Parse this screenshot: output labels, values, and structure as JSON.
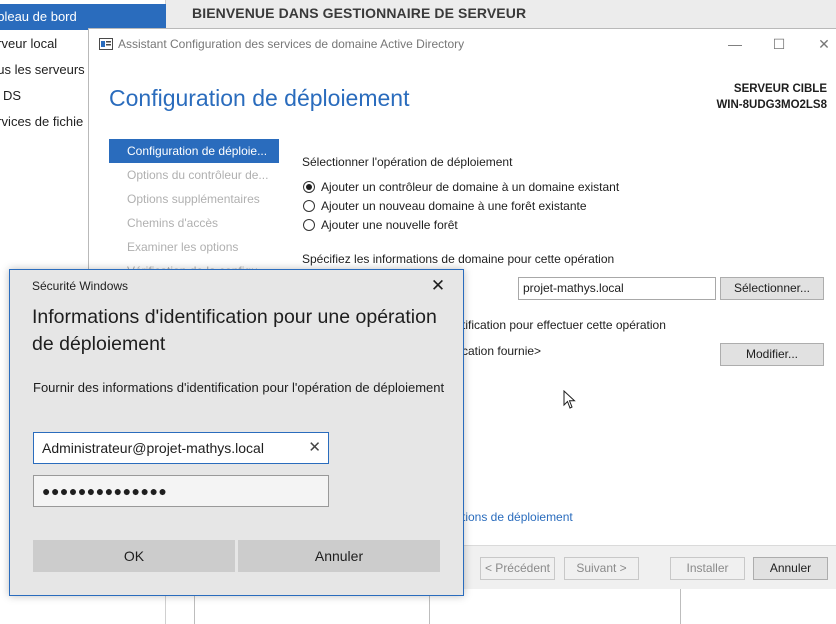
{
  "server_manager": {
    "header_title": "BIENVENUE DANS GESTIONNAIRE DE SERVEUR",
    "sidebar": [
      {
        "label": "ableau de bord",
        "active": true
      },
      {
        "label": "erveur local",
        "active": false
      },
      {
        "label": "ous les serveurs",
        "active": false
      },
      {
        "label": "D DS",
        "active": false
      },
      {
        "label": "ervices de fichie",
        "active": false
      }
    ]
  },
  "wizard": {
    "window_title": "Assistant Configuration des services de domaine Active Directory",
    "heading": "Configuration de déploiement",
    "target_label": "SERVEUR CIBLE",
    "target_name": "WIN-8UDG3MO2LS8",
    "nav": [
      {
        "label": "Configuration de déploie...",
        "active": true
      },
      {
        "label": "Options du contrôleur de...",
        "active": false
      },
      {
        "label": "Options supplémentaires",
        "active": false
      },
      {
        "label": "Chemins d'accès",
        "active": false
      },
      {
        "label": "Examiner les options",
        "active": false
      },
      {
        "label": "Vérification de la configu...",
        "active": false
      }
    ],
    "select_operation_label": "Sélectionner l'opération de déploiement",
    "options": [
      {
        "label": "Ajouter un contrôleur de domaine à un domaine existant",
        "checked": true
      },
      {
        "label": "Ajouter un nouveau domaine à une forêt existante",
        "checked": false
      },
      {
        "label": "Ajouter une nouvelle forêt",
        "checked": false
      }
    ],
    "domain_info_label": "Spécifiez les informations de domaine pour cette opération",
    "domain_value": "projet-mathys.local",
    "select_button": "Sélectionner...",
    "credentials_label_partial": "tification pour effectuer cette opération",
    "credentials_value_partial": "cation fournie>",
    "modify_button": "Modifier...",
    "link_partial": "tions de déploiement",
    "footer": {
      "previous": "< Précédent",
      "next": "Suivant >",
      "install": "Installer",
      "cancel": "Annuler"
    }
  },
  "security_dialog": {
    "title": "Sécurité Windows",
    "heading": "Informations d'identification pour une opération de déploiement",
    "description": "Fournir des informations d'identification pour l'opération de déploiement",
    "username": "Administrateur@projet-mathys.local",
    "password_masked": "●●●●●●●●●●●●●●",
    "ok": "OK",
    "cancel": "Annuler"
  },
  "colors": {
    "accent": "#2a6cbd",
    "dialog_bg": "#e6e6e6",
    "header_bg": "#ececec"
  }
}
